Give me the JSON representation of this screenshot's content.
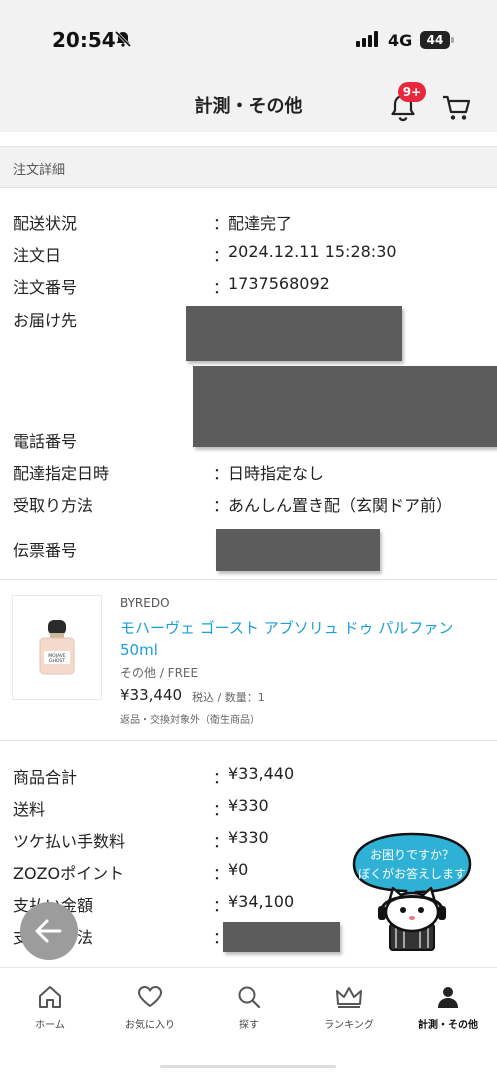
{
  "status_bar": {
    "time": "20:54",
    "network": "4G",
    "battery": "44"
  },
  "header": {
    "title": "計測・その他",
    "notification_badge": "9+"
  },
  "section": {
    "title": "注文詳細"
  },
  "order_info": [
    {
      "label": "配送状況",
      "value": "配達完了"
    },
    {
      "label": "注文日",
      "value": "2024.12.11 15:28:30"
    },
    {
      "label": "注文番号",
      "value": "1737568092"
    },
    {
      "label": "お届け先",
      "value": ""
    },
    {
      "label": "電話番号",
      "value": ""
    },
    {
      "label": "配達指定日時",
      "value": "日時指定なし"
    },
    {
      "label": "受取り方法",
      "value": "あんしん置き配（玄関ドア前）"
    },
    {
      "label": "伝票番号",
      "value": ""
    }
  ],
  "colon": "：",
  "product": {
    "brand": "BYREDO",
    "name": "モハーヴェ ゴースト アブソリュ ドゥ パルファン 50ml",
    "category": "その他 / FREE",
    "price": "¥33,440",
    "price_note": "税込 / 数量：1",
    "return_note": "返品・交換対象外（衛生商品）",
    "image_label_top": "MOJAVE",
    "image_label_bottom": "GHOST"
  },
  "totals": [
    {
      "label": "商品合計",
      "value": "¥33,440"
    },
    {
      "label": "送料",
      "value": "¥330"
    },
    {
      "label": "ツケ払い手数料",
      "value": "¥330"
    },
    {
      "label": "ZOZOポイント",
      "value": "¥0"
    },
    {
      "label": "支払い金額",
      "value": "¥34,100"
    },
    {
      "label": "支払い方法",
      "value": ""
    }
  ],
  "mascot": {
    "line1": "お困りですか？",
    "line2": "ぼくがお答えします"
  },
  "tabs": [
    {
      "label": "ホーム",
      "icon": "home-icon"
    },
    {
      "label": "お気に入り",
      "icon": "heart-icon"
    },
    {
      "label": "探す",
      "icon": "search-icon"
    },
    {
      "label": "ランキング",
      "icon": "crown-icon"
    },
    {
      "label": "計測・その他",
      "icon": "person-icon"
    }
  ],
  "colors": {
    "accent": "#1a9fd8",
    "badge": "#e8283c",
    "redaction": "#5c5c5c"
  }
}
